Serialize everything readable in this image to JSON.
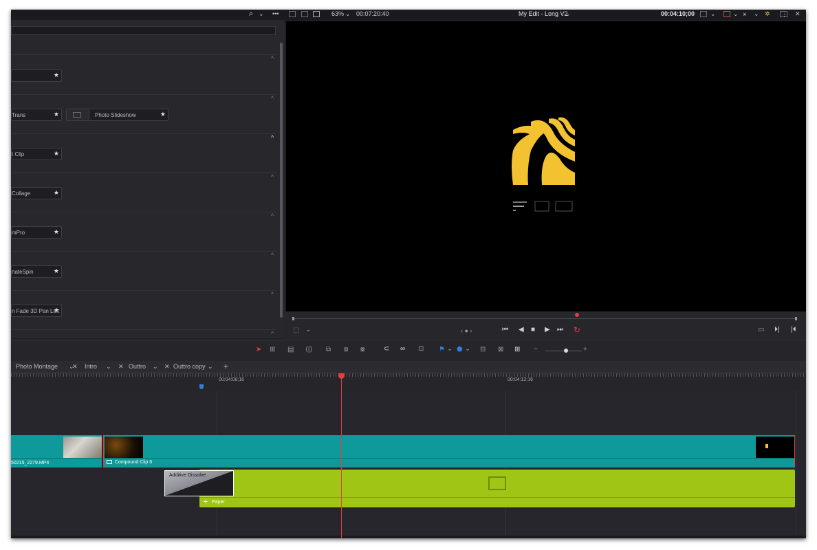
{
  "topbar": {
    "zoom": "63%",
    "duration": "00:07:20:40",
    "edit_title": "My Edit - Long V2",
    "timecode": "00:04:10;00"
  },
  "effects": {
    "items": [
      {
        "label": "",
        "extra": ""
      },
      {
        "label": "Trans",
        "extra": "Photo Slideshow"
      },
      {
        "label": "t Clip"
      },
      {
        "label": "Collage"
      },
      {
        "label": "mPro"
      },
      {
        "label": "nateSpin"
      },
      {
        "label": "n Fade 3D Pan Left"
      }
    ]
  },
  "viewer": {
    "nav_label": "‹ ● ›"
  },
  "timeline": {
    "tabs": [
      "Photo Montage",
      "Intro",
      "Outtro",
      "Outtro copy"
    ],
    "ruler_marks": [
      "00:04:08;16",
      "00:04:12;16"
    ],
    "clips": {
      "clip1_name": "50215_2279.MP4",
      "clip2_name": "Compound Clip 6",
      "transition_name": "Additive Dissolve",
      "gen_name": "Paper"
    }
  },
  "colors": {
    "teal": "#0e9a9a",
    "green": "#9fc614",
    "playhead": "#e0413b",
    "logo": "#f2c230"
  }
}
